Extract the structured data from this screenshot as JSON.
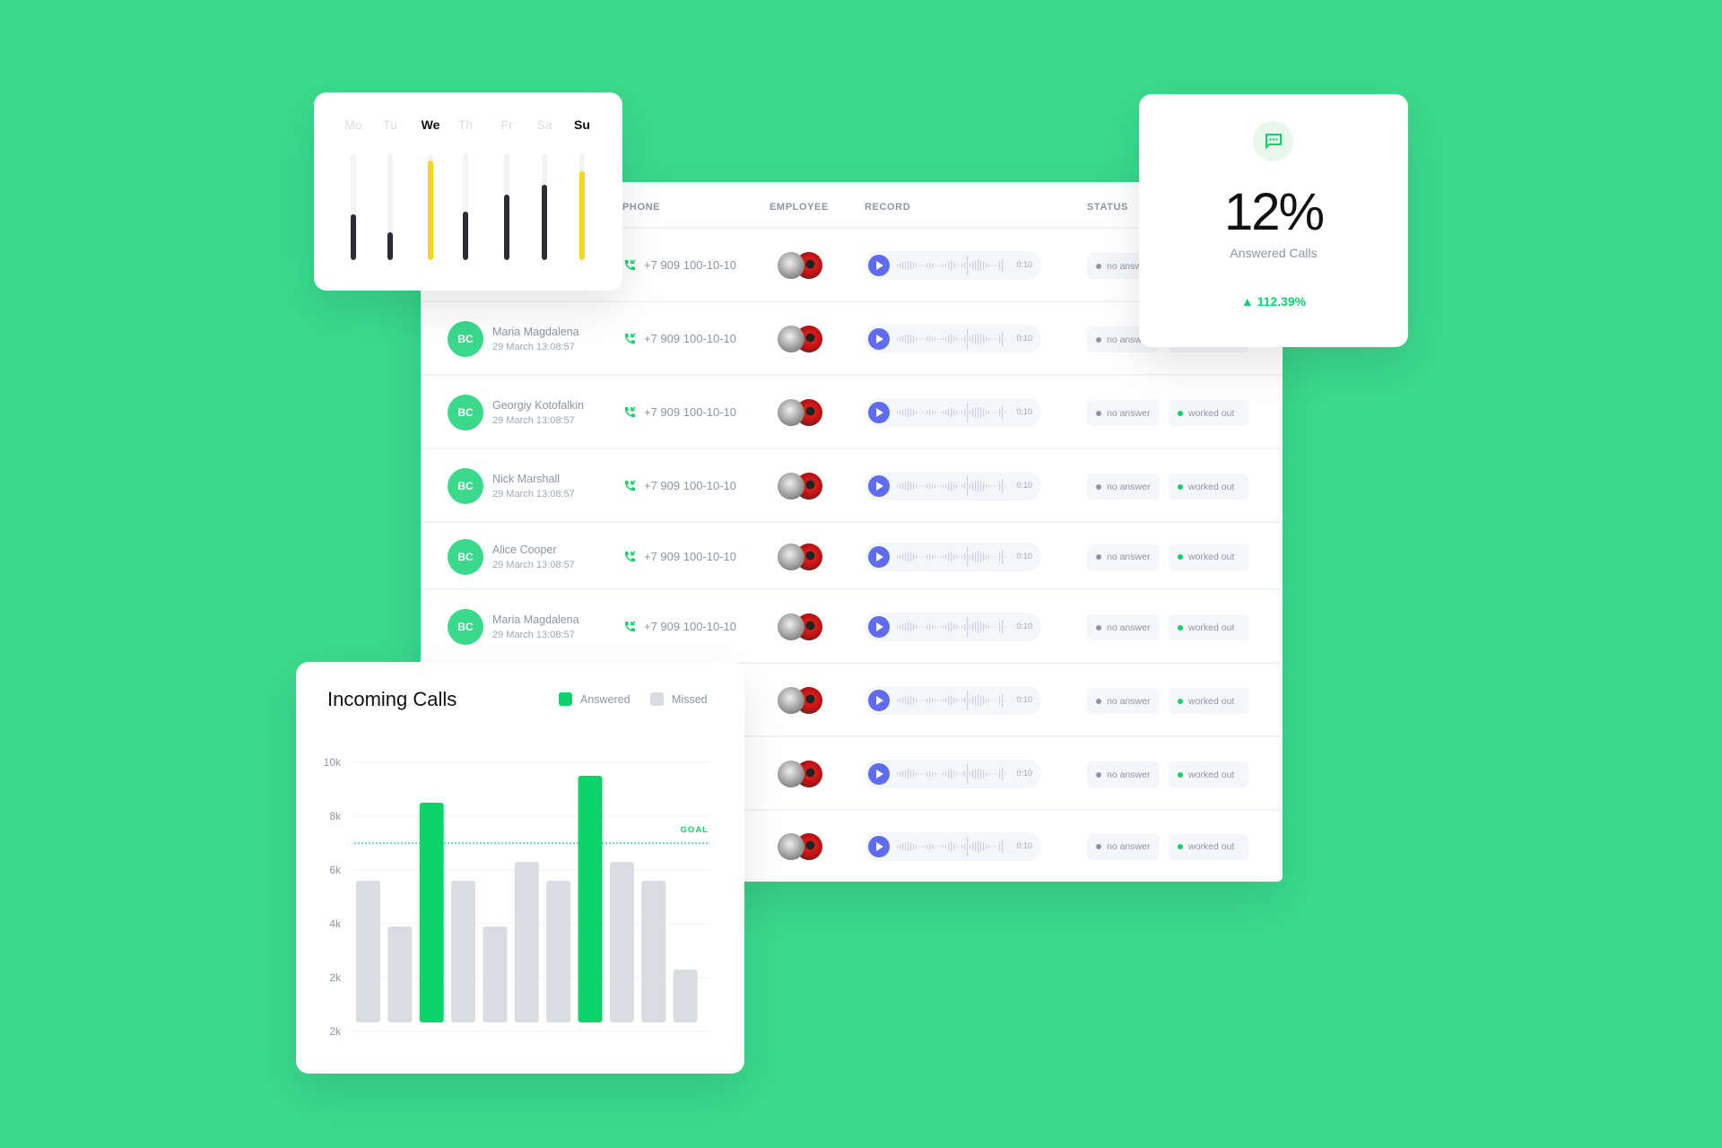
{
  "table": {
    "headers": {
      "phone": "PHONE",
      "employee": "EMPLOYEE",
      "record": "RECORD",
      "status": "STATUS"
    },
    "rows": [
      {
        "initials": "",
        "name": "",
        "date": "",
        "phone": "+7 909 100-10-10",
        "duration": "0:10",
        "status1": "no answer",
        "status2": "worked out"
      },
      {
        "initials": "BC",
        "name": "Maria Magdalena",
        "date": "29 March 13:08:57",
        "phone": "+7 909 100-10-10",
        "duration": "0:10",
        "status1": "no answer",
        "status2": "worked out"
      },
      {
        "initials": "BC",
        "name": "Georgiy Kotofalkin",
        "date": "29 March 13:08:57",
        "phone": "+7 909 100-10-10",
        "duration": "0:10",
        "status1": "no answer",
        "status2": "worked out"
      },
      {
        "initials": "BC",
        "name": "Nick Marshall",
        "date": "29 March 13:08:57",
        "phone": "+7 909 100-10-10",
        "duration": "0:10",
        "status1": "no answer",
        "status2": "worked out"
      },
      {
        "initials": "BC",
        "name": "Alice Cooper",
        "date": "29 March 13:08:57",
        "phone": "+7 909 100-10-10",
        "duration": "0:10",
        "status1": "no answer",
        "status2": "worked out"
      },
      {
        "initials": "BC",
        "name": "Maria Magdalena",
        "date": "29 March 13:08:57",
        "phone": "+7 909 100-10-10",
        "duration": "0:10",
        "status1": "no answer",
        "status2": "worked out"
      },
      {
        "initials": "",
        "name": "",
        "date": "",
        "phone": "",
        "duration": "0:10",
        "status1": "no answer",
        "status2": "worked out"
      },
      {
        "initials": "",
        "name": "",
        "date": "",
        "phone": "",
        "duration": "0:10",
        "status1": "no answer",
        "status2": "worked out"
      },
      {
        "initials": "",
        "name": "",
        "date": "",
        "phone": "",
        "duration": "0:10",
        "status1": "no answer",
        "status2": "worked out"
      }
    ]
  },
  "week": {
    "days": [
      {
        "label": "Mo",
        "level": 0.43,
        "active": false
      },
      {
        "label": "Tu",
        "level": 0.26,
        "active": false
      },
      {
        "label": "We",
        "level": 0.93,
        "active": true
      },
      {
        "label": "Th",
        "level": 0.45,
        "active": false
      },
      {
        "label": "Fr",
        "level": 0.61,
        "active": false
      },
      {
        "label": "Sa",
        "level": 0.71,
        "active": false
      },
      {
        "label": "Su",
        "level": 0.83,
        "active": true
      }
    ],
    "colors": {
      "active": "#fbd51c",
      "inactive": "#2c2b36"
    }
  },
  "answered": {
    "icon": "chat-bubble-icon",
    "value": "12%",
    "label": "Answered Calls",
    "change": "112.39%",
    "trend": "up"
  },
  "colors": {
    "background": "#3ad98c",
    "green": "#0cd46a",
    "play": "#5f6cf0",
    "missed": "#d9dce1"
  },
  "chart_data": {
    "type": "bar",
    "title": "Incoming Calls",
    "legend": [
      {
        "name": "Answered",
        "color": "#0cd46a"
      },
      {
        "name": "Missed",
        "color": "#d9dce1"
      }
    ],
    "legend_position": "top-right",
    "y_ticks": [
      "10k",
      "8k",
      "6k",
      "4k",
      "2k",
      "2k"
    ],
    "ylim": [
      0,
      10000
    ],
    "values": [
      5600,
      3900,
      8500,
      5600,
      3900,
      6300,
      5600,
      9500,
      6300,
      5600,
      2300
    ],
    "series_of_bar": [
      "Missed",
      "Missed",
      "Answered",
      "Missed",
      "Missed",
      "Missed",
      "Missed",
      "Answered",
      "Missed",
      "Missed",
      "Missed"
    ],
    "goal": {
      "label": "GOAL",
      "value": 7000
    },
    "grid": true
  }
}
